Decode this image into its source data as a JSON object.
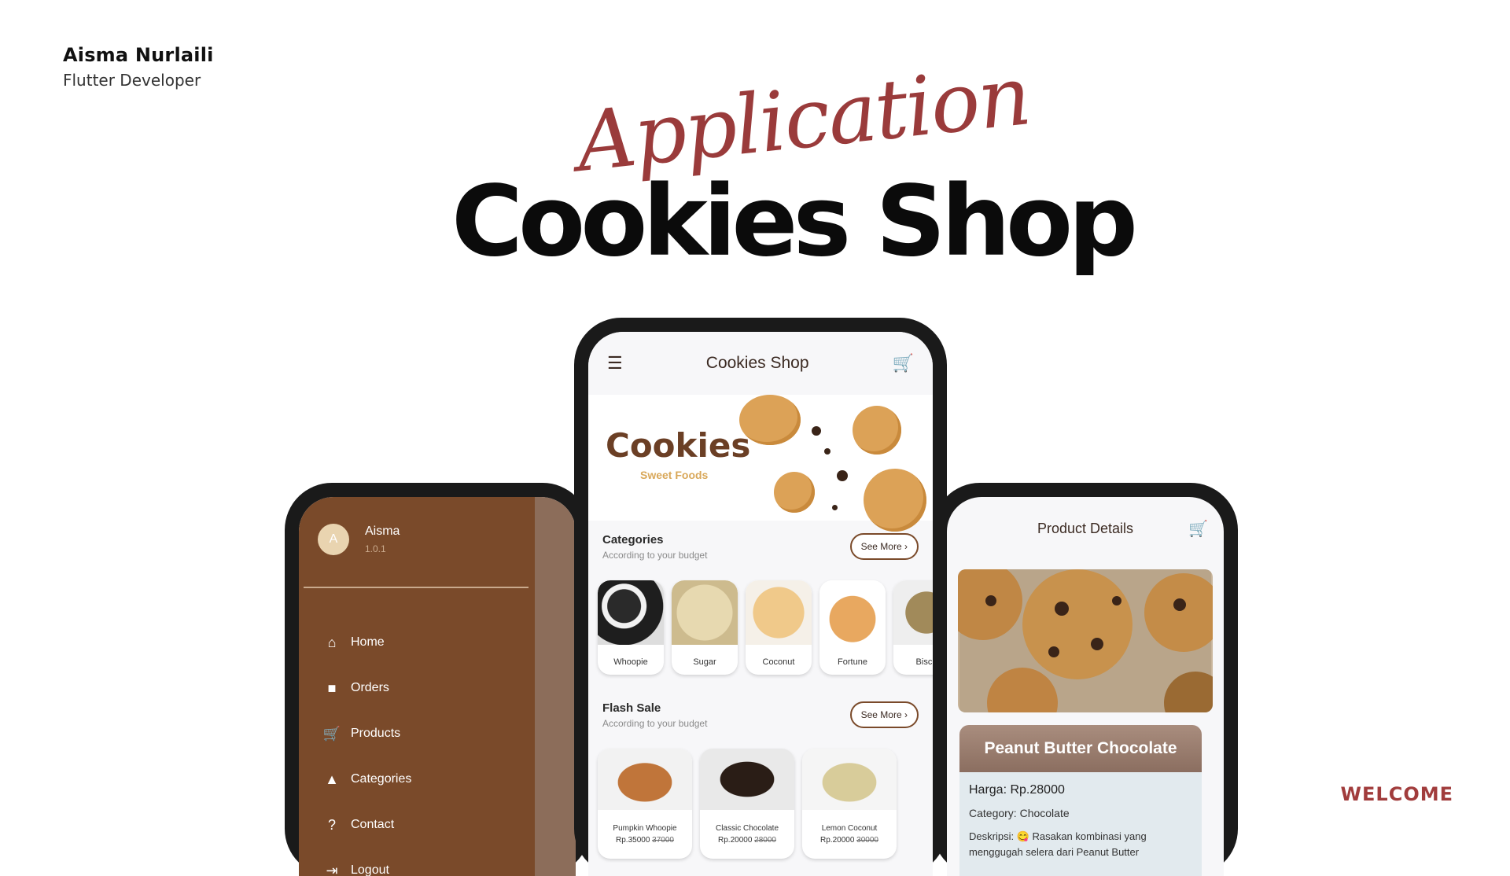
{
  "author": {
    "name": "Aisma Nurlaili",
    "role": "Flutter Developer"
  },
  "hero": {
    "script_word": "Application",
    "title": "Cookies Shop"
  },
  "welcome": "WELCOME",
  "drawer": {
    "avatar_initial": "A",
    "user_name": "Aisma",
    "version": "1.0.1",
    "items": [
      {
        "label": "Home",
        "icon": "home-icon",
        "glyph": "⌂"
      },
      {
        "label": "Orders",
        "icon": "bag-icon",
        "glyph": "■"
      },
      {
        "label": "Products",
        "icon": "cart-icon",
        "glyph": "🛒"
      },
      {
        "label": "Categories",
        "icon": "shapes-icon",
        "glyph": "▲"
      },
      {
        "label": "Contact",
        "icon": "help-icon",
        "glyph": "?"
      },
      {
        "label": "Logout",
        "icon": "logout-icon",
        "glyph": "⇥"
      }
    ]
  },
  "home": {
    "title": "Cookies Shop",
    "banner_title": "Cookies",
    "banner_subtitle": "Sweet Foods",
    "categories": {
      "title": "Categories",
      "subtitle": "According to your budget",
      "see_more": "See More",
      "items": [
        "Whoopie",
        "Sugar",
        "Coconut",
        "Fortune",
        "Biscu"
      ]
    },
    "flash_sale": {
      "title": "Flash Sale",
      "subtitle": "According to your budget",
      "see_more": "See More",
      "items": [
        {
          "name": "Pumpkin Whoopie",
          "price": "Rp.35000",
          "old_price": "37000"
        },
        {
          "name": "Classic Chocolate",
          "price": "Rp.20000",
          "old_price": "28000"
        },
        {
          "name": "Lemon Coconut",
          "price": "Rp.20000",
          "old_price": "30000"
        }
      ]
    }
  },
  "product_details": {
    "title": "Product Details",
    "name": "Peanut Butter Chocolate",
    "price": "Harga: Rp.28000",
    "category": "Category: Chocolate",
    "description": "Deskripsi: 😋 Rasakan kombinasi yang menggugah selera dari Peanut Butter"
  },
  "colors": {
    "brand_brown": "#7a4a2a",
    "accent_red": "#a13c3c",
    "script_red": "#9a3b3b"
  }
}
